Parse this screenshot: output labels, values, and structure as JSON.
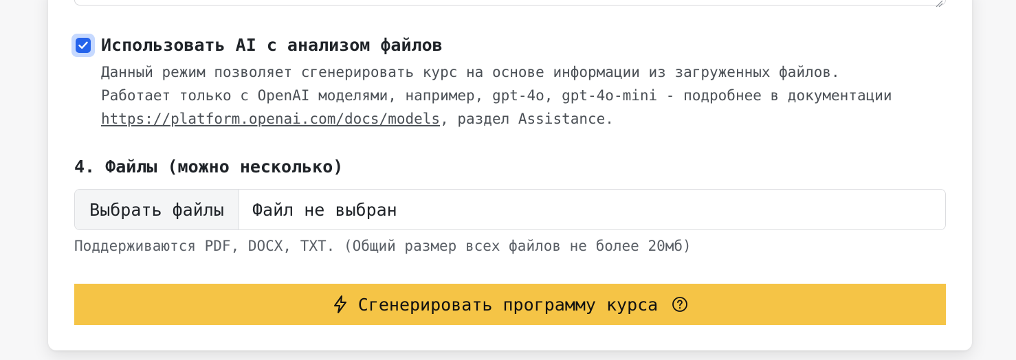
{
  "ai_option": {
    "checked": true,
    "label": "Использовать AI с анализом файлов",
    "description_line1": "Данный режим позволяет сгенерировать курс на основе информации из загруженных файлов.",
    "description_line2": "Работает только с OpenAI моделями, например, gpt-4o, gpt-4o-mini - подробнее в документации",
    "docs_link": "https://platform.openai.com/docs/models",
    "description_tail": ", раздел Assistance."
  },
  "files_section": {
    "title": "4. Файлы (можно несколько)",
    "choose_button": "Выбрать файлы",
    "status": "Файл не выбран",
    "hint": "Поддерживаются PDF, DOCX, TXT. (Общий размер всех файлов не более 20мб)"
  },
  "generate_button": {
    "label": "Сгенерировать программу курса",
    "icon": "lightning-icon",
    "help_icon": "question-circle-icon",
    "color": "#f5c446"
  },
  "colors": {
    "checkbox": "#2563eb",
    "checkbox_focus_ring": "#c6d9ff"
  }
}
